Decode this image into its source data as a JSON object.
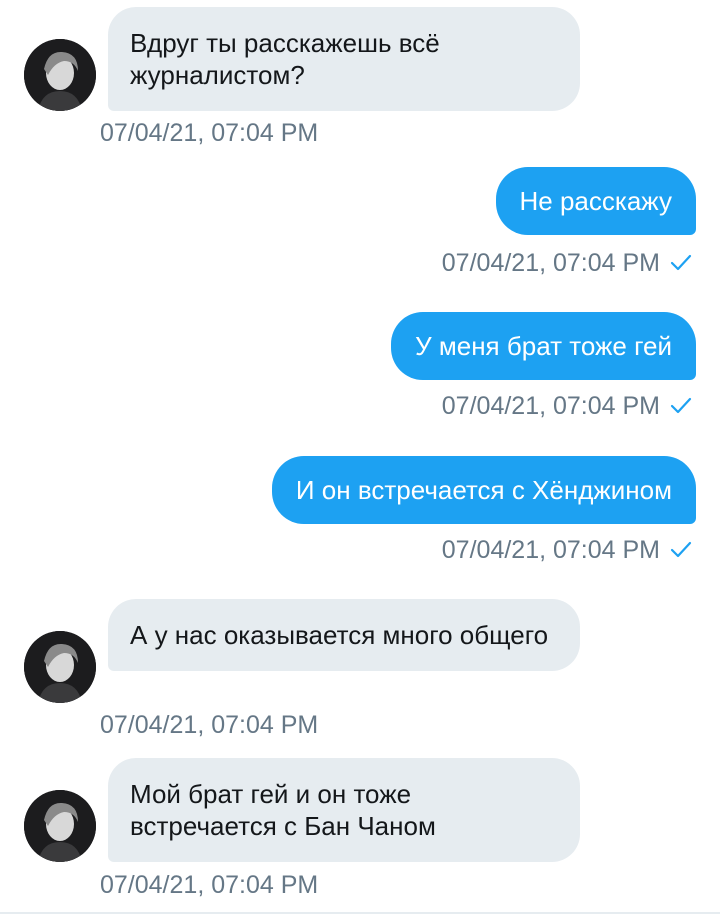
{
  "messages": [
    {
      "direction": "in",
      "text": "Вдруг ты расскажешь всё журналистом?",
      "time": "07/04/21, 07:04 PM"
    },
    {
      "direction": "out",
      "text": "Не расскажу",
      "time": "07/04/21, 07:04 PM"
    },
    {
      "direction": "out",
      "text": "У меня брат тоже гей",
      "time": "07/04/21, 07:04 PM"
    },
    {
      "direction": "out",
      "text": "И он встречается с Хёнджином",
      "time": "07/04/21, 07:04 PM"
    },
    {
      "direction": "in",
      "text": "А у нас оказывается много общего",
      "time": "07/04/21, 07:04 PM"
    },
    {
      "direction": "in",
      "text": "Мой брат гей и он тоже встречается с Бан Чаном",
      "time": "07/04/21, 07:04 PM"
    }
  ],
  "icons": {
    "sent_check": "check-icon",
    "avatar": "avatar"
  },
  "colors": {
    "incoming_bubble": "#e6ecf0",
    "outgoing_bubble": "#1da1f2",
    "timestamp": "#657786",
    "check": "#1da1f2"
  }
}
